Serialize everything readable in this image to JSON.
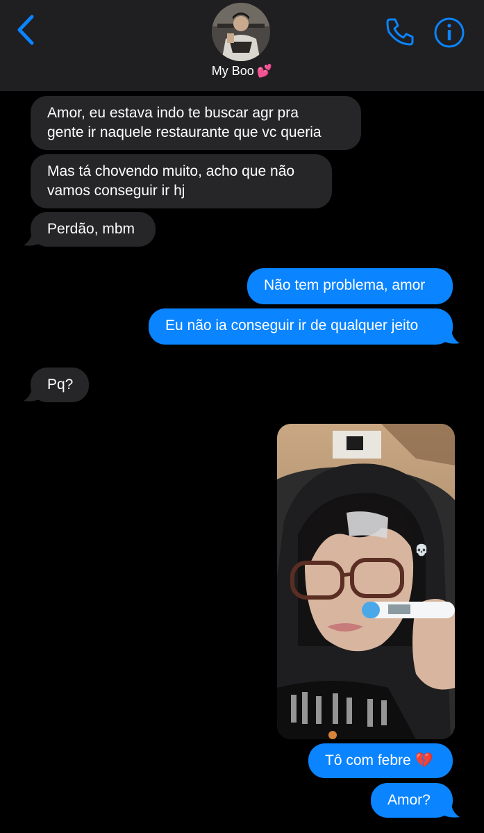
{
  "header": {
    "contact_name": "My Boo",
    "contact_emoji": "💕",
    "back_icon": "chevron-left-icon",
    "call_icon": "phone-icon",
    "info_icon": "info-icon"
  },
  "messages": [
    {
      "direction": "incoming",
      "text_lines": [
        "Amor, eu estava indo te buscar agr pra",
        "gente ir naquele restaurante que vc queria"
      ]
    },
    {
      "direction": "incoming",
      "text_lines": [
        "Mas tá chovendo muito, acho que não",
        "vamos conseguir ir hj"
      ]
    },
    {
      "direction": "incoming",
      "text": "Perdão, mbm"
    },
    {
      "direction": "outgoing",
      "text": "Não tem problema, amor"
    },
    {
      "direction": "outgoing",
      "text": "Eu não ia conseguir ir de qualquer jeito"
    },
    {
      "direction": "incoming",
      "text": "Pq?"
    },
    {
      "direction": "outgoing",
      "type": "image",
      "image": "selfie-with-thermometer",
      "reaction": "💀"
    },
    {
      "direction": "outgoing",
      "text": "Tô com febre",
      "emoji": "💔"
    },
    {
      "direction": "outgoing",
      "text": "Amor?"
    }
  ],
  "colors": {
    "accent": "#0a84ff",
    "incoming_bubble": "#262628",
    "header_bg": "#1f1f21",
    "background": "#000000"
  }
}
